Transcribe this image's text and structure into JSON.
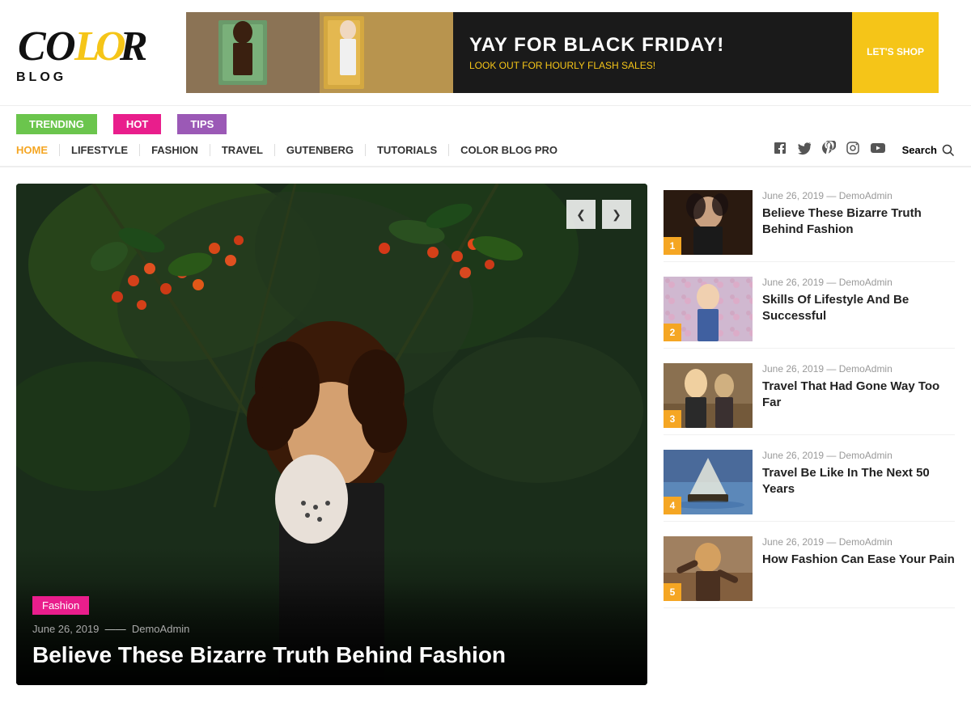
{
  "logo": {
    "color_text": "COLOR",
    "blog_text": "BLOG"
  },
  "banner": {
    "headline": "YAY FOR BLACK FRIDAY!",
    "subtext": "LOOK OUT FOR HOURLY FLASH SALES!",
    "button": "LET'S SHOP"
  },
  "nav_tags": [
    {
      "label": "TRENDING",
      "color": "#6bc54d"
    },
    {
      "label": "HOT",
      "color": "#e91e8c"
    },
    {
      "label": "TIPS",
      "color": "#9b59b6"
    }
  ],
  "main_nav": {
    "items": [
      "HOME",
      "LIFESTYLE",
      "FASHION",
      "TRAVEL",
      "GUTENBERG",
      "TUTORIALS",
      "COLOR BLOG PRO"
    ],
    "search_label": "Search"
  },
  "featured": {
    "tag": "Fashion",
    "date": "June 26, 2019",
    "author": "DemoAdmin",
    "title": "Believe These Bizarre Truth Behind Fashion"
  },
  "sidebar": {
    "items": [
      {
        "number": "1",
        "date": "June 26, 2019",
        "author": "DemoAdmin",
        "title": "Believe These Bizarre Truth Behind Fashion"
      },
      {
        "number": "2",
        "date": "June 26, 2019",
        "author": "DemoAdmin",
        "title": "Skills Of Lifestyle And Be Successful"
      },
      {
        "number": "3",
        "date": "June 26, 2019",
        "author": "DemoAdmin",
        "title": "Travel That Had Gone Way Too Far"
      },
      {
        "number": "4",
        "date": "June 26, 2019",
        "author": "DemoAdmin",
        "title": "Travel Be Like In The Next 50 Years"
      },
      {
        "number": "5",
        "date": "June 26, 2019",
        "author": "DemoAdmin",
        "title": "How Fashion Can Ease Your Pain"
      }
    ]
  },
  "icons": {
    "prev": "❮",
    "next": "❯",
    "search": "🔍",
    "facebook": "f",
    "twitter": "t",
    "pinterest": "p",
    "instagram": "i",
    "youtube": "▶"
  }
}
